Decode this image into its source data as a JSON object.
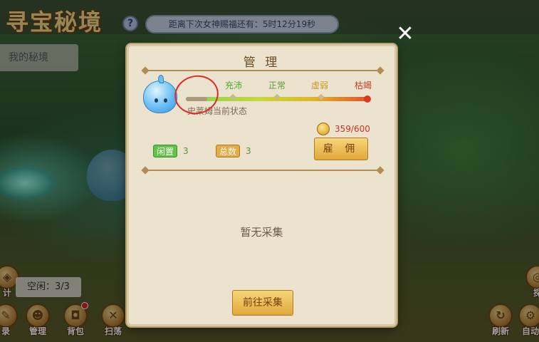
{
  "header": {
    "game_title": "寻宝秘境",
    "help_label": "?",
    "countdown": "距离下次女神赐福还有：5时12分19秒"
  },
  "side_tab": {
    "label": "我的秘境"
  },
  "close_label": "✕",
  "idle_counter": "空闲：3/3",
  "bottom_left": [
    {
      "label": "计",
      "icon": "partial-icon"
    },
    {
      "label": "录",
      "icon": "record-icon"
    },
    {
      "label": "管理",
      "icon": "manage-icon"
    },
    {
      "label": "背包",
      "icon": "bag-icon"
    },
    {
      "label": "扫荡",
      "icon": "sweep-icon"
    }
  ],
  "bottom_right": [
    {
      "label": "探",
      "icon": "explore-icon"
    },
    {
      "label": "刷新",
      "icon": "refresh-icon"
    },
    {
      "label": "自动",
      "icon": "auto-icon"
    }
  ],
  "dialog": {
    "title": "管 理",
    "status_levels": [
      {
        "label": "充沛",
        "color": "#4caa2c"
      },
      {
        "label": "正常",
        "color": "#5b9a3a"
      },
      {
        "label": "虚弱",
        "color": "#c89a22"
      },
      {
        "label": "枯竭",
        "color": "#d03a22"
      }
    ],
    "state_text": "史莱姆当前状态",
    "coins": "359/600",
    "hire_label": "雇 佣",
    "idle_tag": "闲置",
    "idle_count": "3",
    "total_tag": "总数",
    "total_count": "3",
    "empty_text": "暂无采集",
    "go_label": "前往采集"
  },
  "colors": {
    "panel_bg": "#ece3cf",
    "accent_gold": "#e0a83a",
    "annotation_red": "#e02a2a"
  }
}
